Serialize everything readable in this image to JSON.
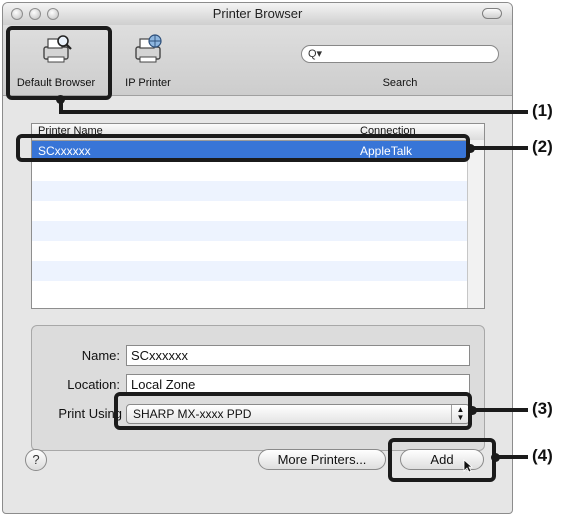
{
  "window": {
    "title": "Printer Browser"
  },
  "toolbar": {
    "items": [
      {
        "label": "Default Browser",
        "icon": "printer-magnifier-icon"
      },
      {
        "label": "IP Printer",
        "icon": "printer-globe-icon"
      }
    ],
    "search": {
      "glyph": "Q▾",
      "label": "Search"
    }
  },
  "list": {
    "headers": {
      "name": "Printer Name",
      "connection": "Connection"
    },
    "rows": [
      {
        "name": "SCxxxxxx",
        "connection": "AppleTalk",
        "selected": true
      }
    ]
  },
  "properties": {
    "name_label": "Name:",
    "name_value": "SCxxxxxx",
    "location_label": "Location:",
    "location_value": "Local Zone",
    "print_using_label": "Print Using",
    "print_using_value": "SHARP MX-xxxx PPD"
  },
  "footer": {
    "help": "?",
    "more_printers": "More Printers...",
    "add": "Add"
  },
  "callouts": [
    "(1)",
    "(2)",
    "(3)",
    "(4)"
  ],
  "colors": {
    "selection": "#3875d7",
    "stripe": "#edf3fe",
    "callout": "#1b1b1b"
  }
}
